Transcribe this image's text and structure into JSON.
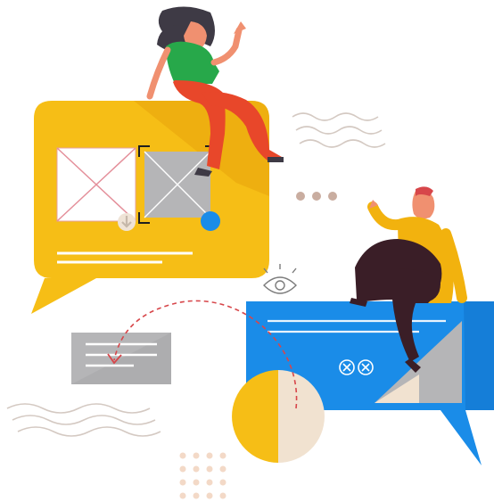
{
  "illustration": {
    "palette": {
      "yellow": "#F6BE16",
      "yellow_shadow": "#E7A30C",
      "blue": "#1A8CE8",
      "blue_shadow": "#0F6FC7",
      "grey_card": "#B5B5B7",
      "wave": "#D4C9C2",
      "dots": "#F3D9C7",
      "cream": "#F1E2D0",
      "red_dash": "#D7464A",
      "skin": "#F09070",
      "hair_dark": "#3E3A45",
      "shirt_green": "#27A84A",
      "pants_red": "#E8472A",
      "shirt_yellow": "#F2B20E",
      "pants_maroon": "#3A1E27"
    },
    "icons": [
      "image-placeholder-icon",
      "image-placeholder-selected-icon",
      "download-icon",
      "eye-icon",
      "close-circle-icon"
    ]
  }
}
